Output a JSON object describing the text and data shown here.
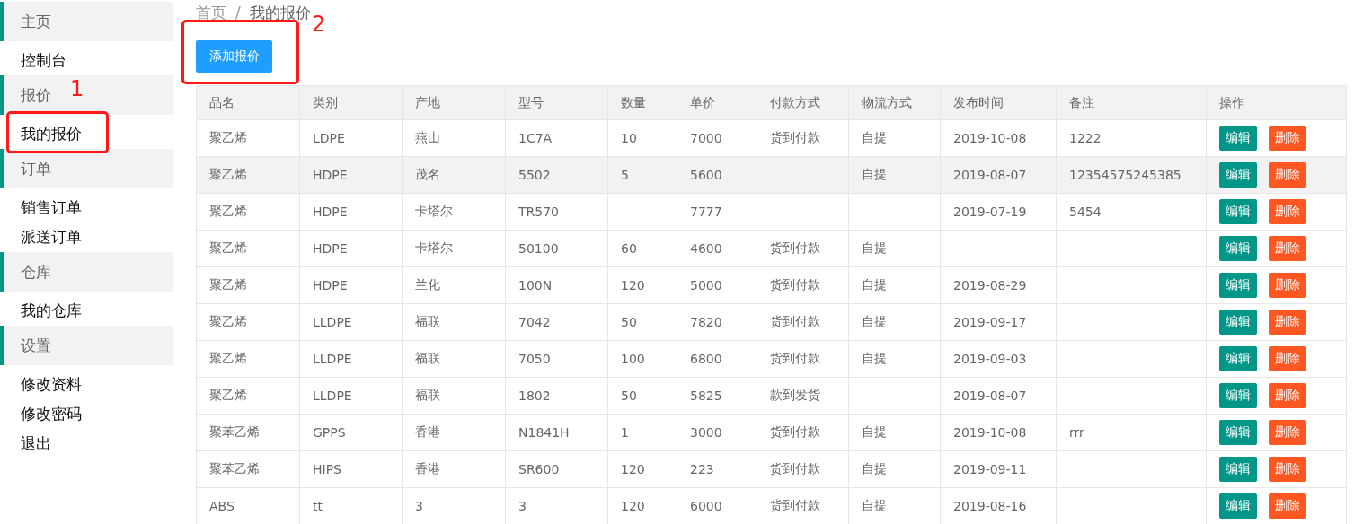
{
  "sidebar": {
    "sections": [
      {
        "title": "主页",
        "items": [
          {
            "label": "控制台"
          }
        ]
      },
      {
        "title": "报价",
        "items": [
          {
            "label": "我的报价"
          }
        ]
      },
      {
        "title": "订单",
        "items": [
          {
            "label": "销售订单"
          },
          {
            "label": "派送订单"
          }
        ]
      },
      {
        "title": "仓库",
        "items": [
          {
            "label": "我的仓库"
          }
        ]
      },
      {
        "title": "设置",
        "items": [
          {
            "label": "修改资料"
          },
          {
            "label": "修改密码"
          },
          {
            "label": "退出"
          }
        ]
      }
    ]
  },
  "breadcrumb": [
    "首页",
    "/",
    "我的报价"
  ],
  "add_button": "添加报价",
  "table": {
    "columns": [
      "品名",
      "类别",
      "产地",
      "型号",
      "数量",
      "单价",
      "付款方式",
      "物流方式",
      "发布时间",
      "备注",
      "操作"
    ],
    "rows": [
      {
        "selected": false,
        "cells": [
          "聚乙烯",
          "LDPE",
          "燕山",
          "1C7A",
          "10",
          "7000",
          "货到付款",
          "自提",
          "2019-10-08",
          "1222"
        ],
        "actions": [
          "编辑",
          "删除"
        ]
      },
      {
        "selected": true,
        "cells": [
          "聚乙烯",
          "HDPE",
          "茂名",
          "5502",
          "5",
          "5600",
          "",
          "自提",
          "2019-08-07",
          "12354575245385"
        ],
        "actions": [
          "编辑",
          "删除"
        ]
      },
      {
        "selected": false,
        "cells": [
          "聚乙烯",
          "HDPE",
          "卡塔尔",
          "TR570",
          "",
          "7777",
          "",
          "",
          "2019-07-19",
          "5454"
        ],
        "actions": [
          "编辑",
          "删除"
        ]
      },
      {
        "selected": false,
        "cells": [
          "聚乙烯",
          "HDPE",
          "卡塔尔",
          "50100",
          "60",
          "4600",
          "货到付款",
          "自提",
          "",
          ""
        ],
        "actions": [
          "编辑",
          "删除"
        ]
      },
      {
        "selected": false,
        "cells": [
          "聚乙烯",
          "HDPE",
          "兰化",
          "100N",
          "120",
          "5000",
          "货到付款",
          "自提",
          "2019-08-29",
          ""
        ],
        "actions": [
          "编辑",
          "删除"
        ]
      },
      {
        "selected": false,
        "cells": [
          "聚乙烯",
          "LLDPE",
          "福联",
          "7042",
          "50",
          "7820",
          "货到付款",
          "自提",
          "2019-09-17",
          ""
        ],
        "actions": [
          "编辑",
          "删除"
        ]
      },
      {
        "selected": false,
        "cells": [
          "聚乙烯",
          "LLDPE",
          "福联",
          "7050",
          "100",
          "6800",
          "货到付款",
          "自提",
          "2019-09-03",
          ""
        ],
        "actions": [
          "编辑",
          "删除"
        ]
      },
      {
        "selected": false,
        "cells": [
          "聚乙烯",
          "LLDPE",
          "福联",
          "1802",
          "50",
          "5825",
          "款到发货",
          "",
          "2019-08-07",
          ""
        ],
        "actions": [
          "编辑",
          "删除"
        ]
      },
      {
        "selected": false,
        "cells": [
          "聚苯乙烯",
          "GPPS",
          "香港",
          "N1841H",
          "1",
          "3000",
          "货到付款",
          "自提",
          "2019-10-08",
          "rrr"
        ],
        "actions": [
          "编辑",
          "删除"
        ]
      },
      {
        "selected": false,
        "cells": [
          "聚苯乙烯",
          "HIPS",
          "香港",
          "SR600",
          "120",
          "223",
          "货到付款",
          "自提",
          "2019-09-11",
          ""
        ],
        "actions": [
          "编辑",
          "删除"
        ]
      },
      {
        "selected": false,
        "cells": [
          "ABS",
          "tt",
          "3",
          "3",
          "120",
          "6000",
          "货到付款",
          "自提",
          "2019-08-16",
          ""
        ],
        "actions": [
          "编辑",
          "删除"
        ]
      }
    ]
  },
  "annotations": [
    {
      "label": "1",
      "kind": "sidebar"
    },
    {
      "label": "2",
      "kind": "button"
    }
  ]
}
